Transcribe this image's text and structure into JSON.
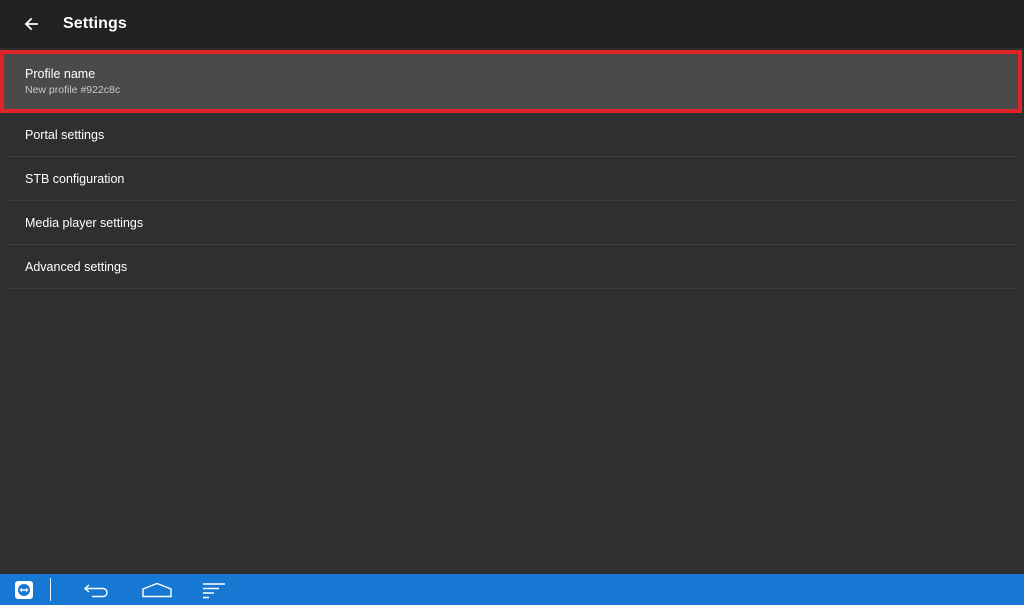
{
  "toolbar": {
    "title": "Settings",
    "back_icon": "arrow-left-icon"
  },
  "settings": {
    "items": [
      {
        "title": "Profile name",
        "summary": "New profile #922c8c",
        "selected": true
      },
      {
        "title": "Portal settings"
      },
      {
        "title": "STB configuration"
      },
      {
        "title": "Media player settings"
      },
      {
        "title": "Advanced settings"
      }
    ]
  },
  "system_bar": {
    "icons": [
      "teamviewer-icon",
      "back-icon",
      "home-icon",
      "recents-icon"
    ]
  },
  "colors": {
    "toolbar_bg": "#212121",
    "content_bg": "#2f2f2f",
    "selected_bg": "#4a4a4a",
    "highlight_border": "#e0252a",
    "system_bar_bg": "#1678d2"
  }
}
